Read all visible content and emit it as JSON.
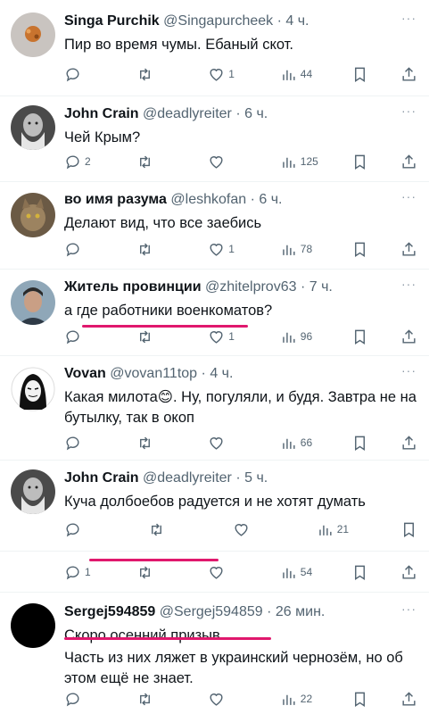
{
  "tweets": [
    {
      "name": "Singa Purchik",
      "handle": "@Singapurcheek",
      "dot": "·",
      "time": "4 ч.",
      "text": "Пир во время чумы. Ебаный скот.",
      "replies": "",
      "retweets": "",
      "likes": "1",
      "views": "44"
    },
    {
      "name": "John Crain",
      "handle": "@deadlyreiter",
      "dot": "·",
      "time": "6 ч.",
      "text": "Чей Крым?",
      "replies": "2",
      "retweets": "",
      "likes": "",
      "views": "125"
    },
    {
      "name": "во имя разума",
      "handle": "@leshkofan",
      "dot": "·",
      "time": "6 ч.",
      "text": "Делают вид, что все заебись",
      "replies": "",
      "retweets": "",
      "likes": "1",
      "views": "78"
    },
    {
      "name": "Житель провинции",
      "handle": "@zhitelprov63",
      "dot": "·",
      "time": "7 ч.",
      "text": "а где работники военкоматов?",
      "replies": "",
      "retweets": "",
      "likes": "1",
      "views": "96"
    },
    {
      "name": "Vovan",
      "handle": "@vovan11top",
      "dot": "·",
      "time": "4 ч.",
      "text": "Какая милота😊. Ну, погуляли, и будя. Завтра не на бутылку, так в окоп",
      "replies": "",
      "retweets": "",
      "likes": "",
      "views": "66"
    },
    {
      "name": "John Crain",
      "handle": "@deadlyreiter",
      "dot": "·",
      "time": "5 ч.",
      "text": "Куча долбоебов радуется и не хотят думать",
      "replies": "",
      "retweets": "",
      "likes": "",
      "views": "21"
    },
    {
      "name": "",
      "handle": "",
      "dot": "",
      "time": "",
      "text": "",
      "replies": "1",
      "retweets": "",
      "likes": "",
      "views": "54"
    },
    {
      "name": "Sergej594859",
      "handle": "@Sergej594859",
      "dot": "·",
      "time": "26 мин.",
      "text": "Скоро осенний призыв.",
      "text2": "Часть из них ляжет в украинский чернозём, но об этом ещё не знает.",
      "replies": "",
      "retweets": "",
      "likes": "",
      "views": "22"
    }
  ],
  "more_label": "···",
  "icons": [
    "reply-icon",
    "retweet-icon",
    "like-icon",
    "views-icon",
    "bookmark-icon",
    "share-icon"
  ],
  "colors": {
    "underline": "#e0186d",
    "text": "#0f1419",
    "muted": "#536471"
  }
}
